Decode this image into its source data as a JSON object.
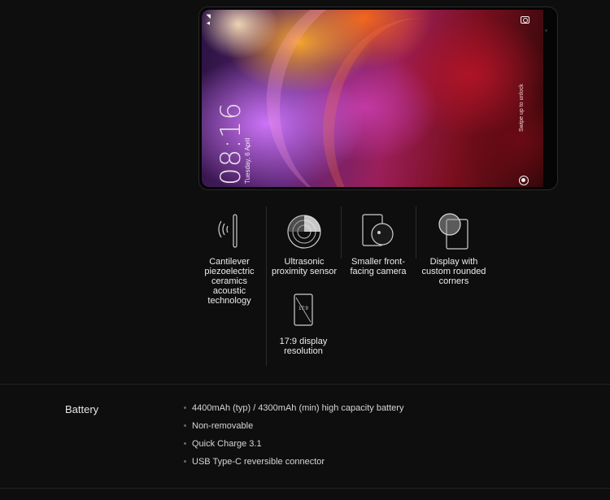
{
  "phone": {
    "time": "08:16",
    "date": "Tuesday, 6 April",
    "swipe_hint": "Swipe up to unlock",
    "status": "▲ ◢"
  },
  "features": [
    {
      "icon": "acoustic-speaker-icon",
      "label": "Cantilever piezoelectric ceramics acoustic technology"
    },
    {
      "icon": "proximity-sensor-icon",
      "label": "Ultrasonic proximity sensor"
    },
    {
      "icon": "front-camera-icon",
      "label": "Smaller front-facing camera"
    },
    {
      "icon": "rounded-corners-icon",
      "label": "Display with custom rounded corners"
    },
    {
      "icon": "aspect-ratio-icon",
      "label": "17:9 display resolution",
      "icon_text": "17:9"
    }
  ],
  "battery": {
    "title": "Battery",
    "items": [
      "4400mAh (typ) / 4300mAh (min) high capacity battery",
      "Non-removable",
      "Quick Charge 3.1",
      "USB Type-C reversible connector"
    ]
  },
  "colors": {
    "background": "#0e0e0e",
    "text": "#ececec",
    "divider": "#242424"
  }
}
